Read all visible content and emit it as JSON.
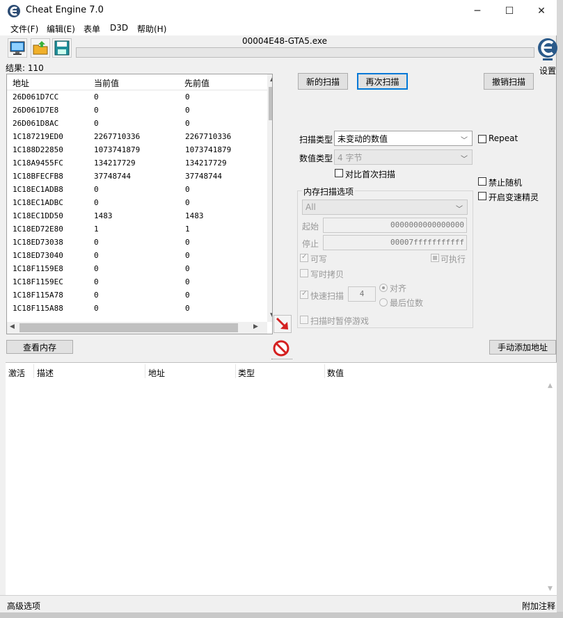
{
  "window": {
    "title": "Cheat Engine 7.0",
    "controls": {
      "minimize": "─",
      "maximize": "☐",
      "close": "✕"
    }
  },
  "menu": [
    "文件(F)",
    "编辑(E)",
    "表单",
    "D3D",
    "帮助(H)"
  ],
  "toolbar": {
    "icons": [
      "open-process-icon",
      "open-table-icon",
      "save-table-icon"
    ],
    "process_name": "00004E48-GTA5.exe",
    "settings_label": "设置"
  },
  "results": {
    "count_label": "结果: 110",
    "headers": {
      "address": "地址",
      "current": "当前值",
      "previous": "先前值"
    },
    "rows": [
      {
        "address": "26D061D7CC",
        "current": "0",
        "previous": "0"
      },
      {
        "address": "26D061D7E8",
        "current": "0",
        "previous": "0"
      },
      {
        "address": "26D061D8AC",
        "current": "0",
        "previous": "0"
      },
      {
        "address": "1C187219ED0",
        "current": "2267710336",
        "previous": "2267710336"
      },
      {
        "address": "1C188D22850",
        "current": "1073741879",
        "previous": "1073741879"
      },
      {
        "address": "1C18A9455FC",
        "current": "134217729",
        "previous": "134217729"
      },
      {
        "address": "1C18BFECFB8",
        "current": "37748744",
        "previous": "37748744"
      },
      {
        "address": "1C18EC1ADB8",
        "current": "0",
        "previous": "0"
      },
      {
        "address": "1C18EC1ADBC",
        "current": "0",
        "previous": "0"
      },
      {
        "address": "1C18EC1DD50",
        "current": "1483",
        "previous": "1483"
      },
      {
        "address": "1C18ED72E80",
        "current": "1",
        "previous": "1"
      },
      {
        "address": "1C18ED73038",
        "current": "0",
        "previous": "0"
      },
      {
        "address": "1C18ED73040",
        "current": "0",
        "previous": "0"
      },
      {
        "address": "1C18F1159E8",
        "current": "0",
        "previous": "0"
      },
      {
        "address": "1C18F1159EC",
        "current": "0",
        "previous": "0"
      },
      {
        "address": "1C18F115A78",
        "current": "0",
        "previous": "0"
      },
      {
        "address": "1C18F115A88",
        "current": "0",
        "previous": "0"
      }
    ]
  },
  "buttons": {
    "new_scan": "新的扫描",
    "next_scan": "再次扫描",
    "undo_scan": "撤销扫描",
    "view_memory": "查看内存",
    "add_address": "手动添加地址"
  },
  "scan_options": {
    "scan_type_label": "扫描类型",
    "scan_type_value": "未变动的数值",
    "value_type_label": "数值类型",
    "value_type_value": "4 字节",
    "compare_first_label": "对比首次扫描",
    "repeat_label": "Repeat",
    "no_random_label": "禁止随机",
    "speedhack_label": "开启变速精灵"
  },
  "memory_options": {
    "group_label": "内存扫描选项",
    "region_value": "All",
    "start_label": "起始",
    "start_value": "0000000000000000",
    "stop_label": "停止",
    "stop_value": "00007fffffffffff",
    "writable_label": "可写",
    "executable_label": "可执行",
    "copy_on_write_label": "写时拷贝",
    "fast_scan_label": "快速扫描",
    "fast_scan_value": "4",
    "align_label": "对齐",
    "last_digits_label": "最后位数",
    "pause_label": "扫描时暂停游戏"
  },
  "address_list": {
    "headers": {
      "active": "激活",
      "description": "描述",
      "address": "地址",
      "type": "类型",
      "value": "数值"
    }
  },
  "status_bar": {
    "left": "高级选项",
    "right": "附加注释"
  }
}
